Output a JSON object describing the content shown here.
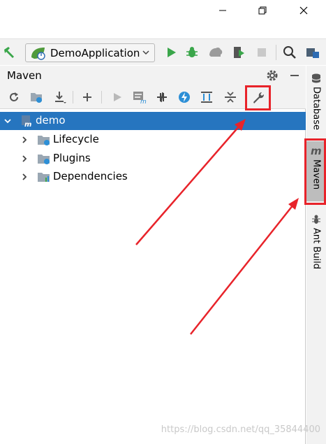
{
  "toolbar": {
    "run_config_label": "DemoApplication"
  },
  "maven_panel": {
    "title": "Maven"
  },
  "tree": {
    "items": [
      {
        "label": "demo",
        "selected": true
      },
      {
        "label": "Lifecycle"
      },
      {
        "label": "Plugins"
      },
      {
        "label": "Dependencies"
      }
    ]
  },
  "right_stripe": {
    "items": [
      {
        "label": "Database"
      },
      {
        "label": "Maven",
        "active": true
      },
      {
        "label": "Ant Build"
      }
    ]
  },
  "watermark": "https://blog.csdn.net/qq_35844400",
  "colors": {
    "selection": "#2675bf",
    "annotation": "#e8232a",
    "run_green": "#3aa64a"
  },
  "icons": [
    "minimize-icon",
    "restore-icon",
    "close-icon",
    "hammer-icon",
    "spring-boot-icon",
    "chevron-down-icon",
    "run-icon",
    "debug-icon",
    "profile-icon",
    "coverage-icon",
    "stop-icon",
    "search-icon",
    "project-structure-icon",
    "gear-icon",
    "hide-icon",
    "reload-icon",
    "generate-sources-icon",
    "download-icon",
    "add-icon",
    "execute-goal-icon",
    "run-maven-icon",
    "toggle-offline-icon",
    "skip-tests-icon",
    "show-dependencies-icon",
    "collapse-all-icon",
    "maven-settings-wrench-icon",
    "database-icon",
    "maven-icon",
    "ant-icon"
  ]
}
